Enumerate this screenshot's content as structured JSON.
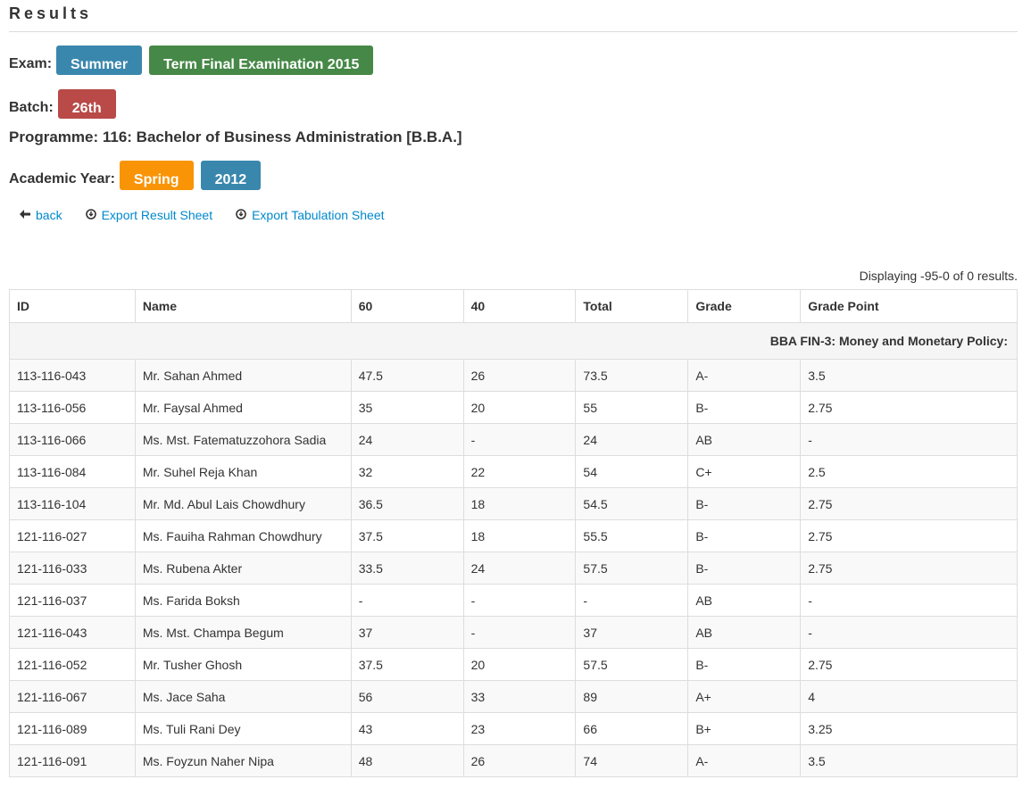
{
  "page": {
    "title": "Results"
  },
  "exam": {
    "label": "Exam:",
    "session": "Summer",
    "name": "Term Final Examination 2015"
  },
  "batch": {
    "label": "Batch:",
    "value": "26th"
  },
  "programme": {
    "text": "Programme: 116: Bachelor of Business Administration [B.B.A.]"
  },
  "academic_year": {
    "label": "Academic Year:",
    "season": "Spring",
    "year": "2012"
  },
  "links": {
    "back": "back",
    "export_result": "Export Result Sheet",
    "export_tabulation": "Export Tabulation Sheet"
  },
  "icons": {
    "back": "arrow-left-icon",
    "export": "circle-download-icon"
  },
  "colors": {
    "blue": "#3a87ad",
    "green": "#468847",
    "red": "#b94a48",
    "orange": "#f89406",
    "link": "#0088cc"
  },
  "summary": "Displaying -95-0 of 0 results.",
  "table": {
    "headers": [
      "ID",
      "Name",
      "60",
      "40",
      "Total",
      "Grade",
      "Grade Point"
    ],
    "group_title": "BBA FIN-3: Money and Monetary Policy:",
    "rows": [
      [
        "113-116-043",
        "Mr. Sahan Ahmed",
        "47.5",
        "26",
        "73.5",
        "A-",
        "3.5"
      ],
      [
        "113-116-056",
        "Mr. Faysal Ahmed",
        "35",
        "20",
        "55",
        "B-",
        "2.75"
      ],
      [
        "113-116-066",
        "Ms. Mst. Fatematuzzohora Sadia",
        "24",
        "-",
        "24",
        "AB",
        "-"
      ],
      [
        "113-116-084",
        "Mr. Suhel Reja Khan",
        "32",
        "22",
        "54",
        "C+",
        "2.5"
      ],
      [
        "113-116-104",
        "Mr. Md. Abul Lais Chowdhury",
        "36.5",
        "18",
        "54.5",
        "B-",
        "2.75"
      ],
      [
        "121-116-027",
        "Ms. Fauiha Rahman Chowdhury",
        "37.5",
        "18",
        "55.5",
        "B-",
        "2.75"
      ],
      [
        "121-116-033",
        "Ms. Rubena Akter",
        "33.5",
        "24",
        "57.5",
        "B-",
        "2.75"
      ],
      [
        "121-116-037",
        "Ms. Farida Boksh",
        "-",
        "-",
        "-",
        "AB",
        "-"
      ],
      [
        "121-116-043",
        "Ms. Mst. Champa Begum",
        "37",
        "-",
        "37",
        "AB",
        "-"
      ],
      [
        "121-116-052",
        "Mr. Tusher Ghosh",
        "37.5",
        "20",
        "57.5",
        "B-",
        "2.75"
      ],
      [
        "121-116-067",
        "Ms. Jace Saha",
        "56",
        "33",
        "89",
        "A+",
        "4"
      ],
      [
        "121-116-089",
        "Ms. Tuli Rani Dey",
        "43",
        "23",
        "66",
        "B+",
        "3.25"
      ],
      [
        "121-116-091",
        "Ms. Foyzun Naher Nipa",
        "48",
        "26",
        "74",
        "A-",
        "3.5"
      ]
    ]
  }
}
